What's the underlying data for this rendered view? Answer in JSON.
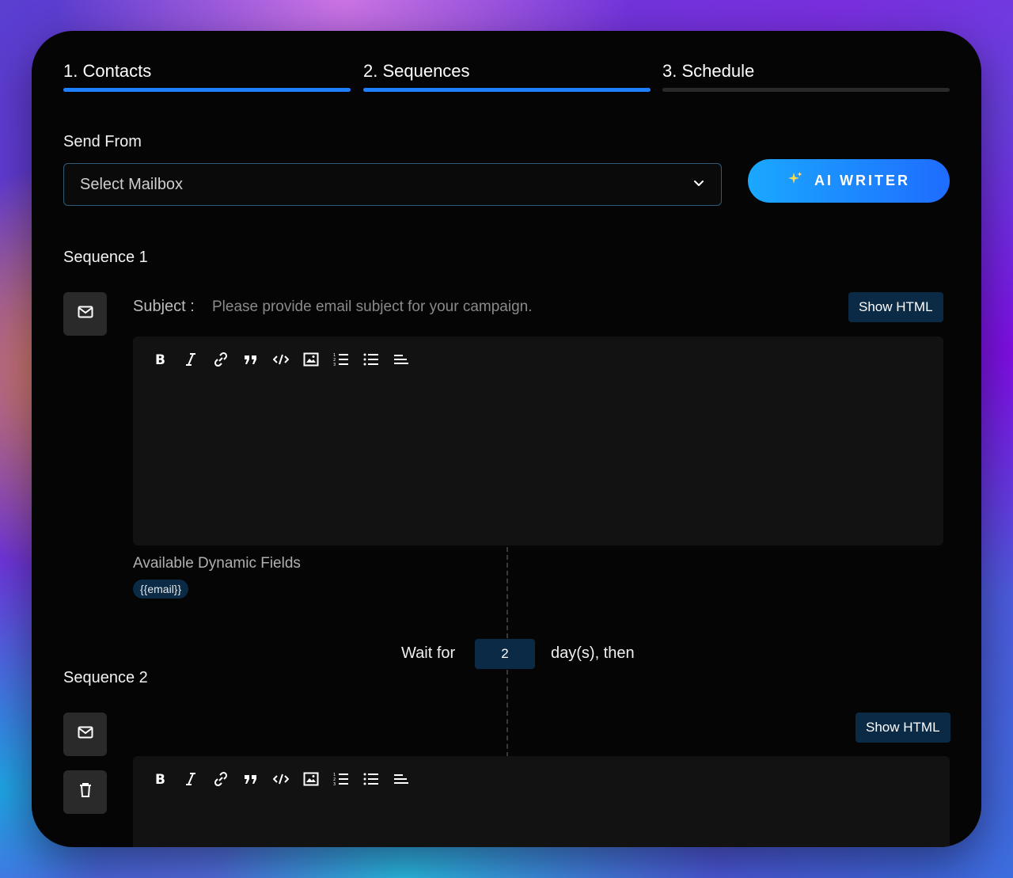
{
  "tabs": [
    {
      "label": "1. Contacts",
      "active": true
    },
    {
      "label": "2. Sequences",
      "active": true
    },
    {
      "label": "3. Schedule",
      "active": false
    }
  ],
  "send_from": {
    "label": "Send From",
    "select_placeholder": "Select Mailbox"
  },
  "ai_writer": {
    "label": "AI WRITER",
    "icon": "sparkles-icon"
  },
  "sequence1": {
    "title": "Sequence 1",
    "subject_label": "Subject :",
    "subject_placeholder": "Please provide email subject for your campaign.",
    "show_html_label": "Show HTML",
    "dynamic_fields_title": "Available Dynamic Fields",
    "dynamic_fields": [
      "{{email}}"
    ]
  },
  "wait": {
    "prefix": "Wait for",
    "value": "2",
    "suffix": "day(s), then"
  },
  "sequence2": {
    "title": "Sequence 2",
    "show_html_label": "Show HTML"
  },
  "toolbar_icons": [
    "bold-icon",
    "italic-icon",
    "link-icon",
    "quote-icon",
    "code-icon",
    "image-icon",
    "ordered-list-icon",
    "bullet-list-icon",
    "align-left-icon"
  ],
  "colors": {
    "accent": "#1f80ff",
    "panel_bg": "#050505",
    "chip_bg": "#0a2a45"
  }
}
